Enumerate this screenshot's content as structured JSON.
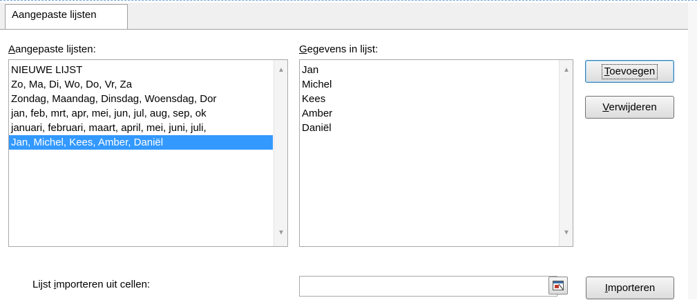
{
  "tab": {
    "label": "Aangepaste lijsten"
  },
  "left_panel": {
    "label_prefix": "A",
    "label_rest": "angepaste lijsten:",
    "items": [
      "NIEUWE LIJST",
      "Zo, Ma, Di, Wo, Do, Vr, Za",
      "Zondag, Maandag, Dinsdag, Woensdag, Dor",
      "jan, feb, mrt, apr, mei, jun, jul, aug, sep, ok",
      "januari, februari, maart, april, mei, juni, juli,",
      "Jan, Michel, Kees, Amber, Daniël"
    ],
    "selected_index": 5
  },
  "right_panel": {
    "label_prefix": "G",
    "label_rest": "egevens in lijst:",
    "entries": [
      "Jan",
      "Michel",
      "Kees",
      "Amber",
      "Daniël"
    ]
  },
  "buttons": {
    "add": {
      "mnemonic": "T",
      "rest": "oevoegen"
    },
    "delete": {
      "mnemonic": "V",
      "rest": "erwijderen"
    },
    "import": {
      "mnemonic": "I",
      "rest": "mporteren"
    }
  },
  "import_row": {
    "label_before": "Lijst ",
    "label_mnemonic": "i",
    "label_after": "mporteren uit cellen:",
    "value": ""
  },
  "icons": {
    "scroll_up": "scroll-up-arrow-icon",
    "scroll_down": "scroll-down-arrow-icon",
    "range_picker": "range-picker-icon"
  }
}
